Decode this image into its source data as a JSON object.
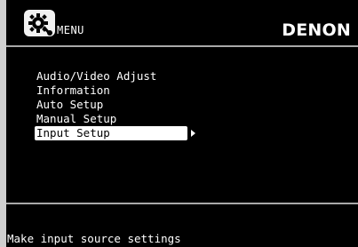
{
  "header": {
    "menu_label": "MENU",
    "brand": "DENON",
    "menu_icon": "gear-wrench-icon"
  },
  "menu": {
    "items": [
      {
        "label": "Audio/Video Adjust",
        "selected": false
      },
      {
        "label": "Information",
        "selected": false
      },
      {
        "label": "Auto Setup",
        "selected": false
      },
      {
        "label": "Manual Setup",
        "selected": false
      },
      {
        "label": "Input Setup",
        "selected": true,
        "has_submenu": true
      }
    ],
    "submenu_icon": "arrow-right-icon"
  },
  "status": {
    "text": "Make input source settings"
  },
  "colors": {
    "background": "#000000",
    "text": "#ffffff",
    "highlight": "#ffffff",
    "rule": "#a9a9a9",
    "frame": "#cfcfcf"
  }
}
